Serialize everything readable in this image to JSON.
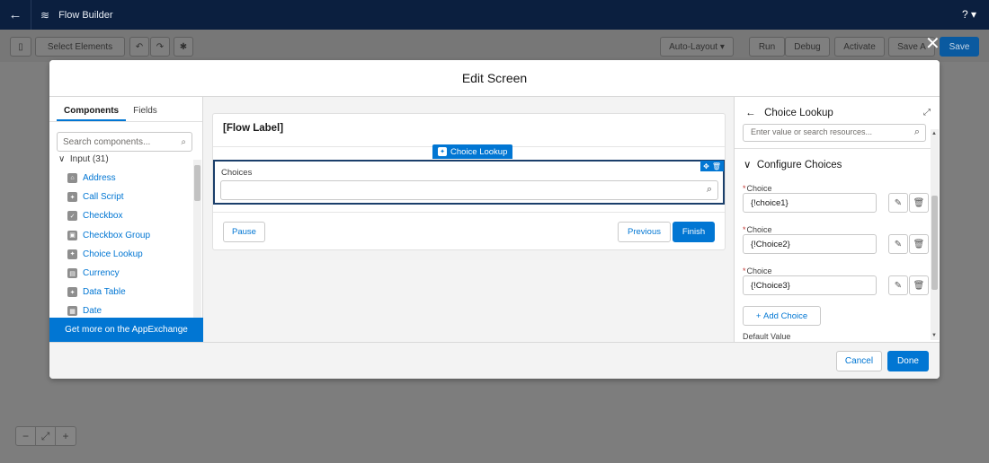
{
  "header": {
    "title": "Flow Builder",
    "help_label": "? ▾"
  },
  "toolbar": {
    "select_elements": "Select Elements",
    "layout": "Auto-Layout",
    "run": "Run",
    "debug": "Debug",
    "activate": "Activate",
    "save_as": "Save A",
    "save": "Save"
  },
  "modal": {
    "title": "Edit Screen",
    "close_symbol": "✕",
    "cancel_label": "Cancel",
    "done_label": "Done"
  },
  "left_panel": {
    "tabs": [
      {
        "label": "Components",
        "active": true
      },
      {
        "label": "Fields",
        "active": false
      }
    ],
    "search_placeholder": "Search components...",
    "group": "Input (31)",
    "components": [
      {
        "label": "Address",
        "icon": "address-icon"
      },
      {
        "label": "Call Script",
        "icon": "call-script-icon"
      },
      {
        "label": "Checkbox",
        "icon": "checkbox-icon"
      },
      {
        "label": "Checkbox Group",
        "icon": "checkbox-group-icon"
      },
      {
        "label": "Choice Lookup",
        "icon": "choice-lookup-icon"
      },
      {
        "label": "Currency",
        "icon": "currency-icon"
      },
      {
        "label": "Data Table",
        "icon": "data-table-icon"
      },
      {
        "label": "Date",
        "icon": "date-icon"
      }
    ],
    "appexchange_label": "Get more on the AppExchange"
  },
  "canvas": {
    "flow_label": "[Flow Label]",
    "component_tag": "Choice Lookup",
    "field_label": "Choices",
    "buttons": {
      "pause": "Pause",
      "previous": "Previous",
      "finish": "Finish"
    }
  },
  "right_panel": {
    "title": "Choice Lookup",
    "search_placeholder": "Enter value or search resources...",
    "section_title": "Configure Choices",
    "choice_label": "Choice",
    "choices": [
      "{!choice1}",
      "{!Choice2}",
      "{!Choice3}"
    ],
    "add_choice_label": "Add Choice",
    "default_value_label": "Default Value"
  },
  "colors": {
    "brand": "#0176d3",
    "header_bg": "#0b1f3f",
    "overlay": "#7d7d7d"
  }
}
